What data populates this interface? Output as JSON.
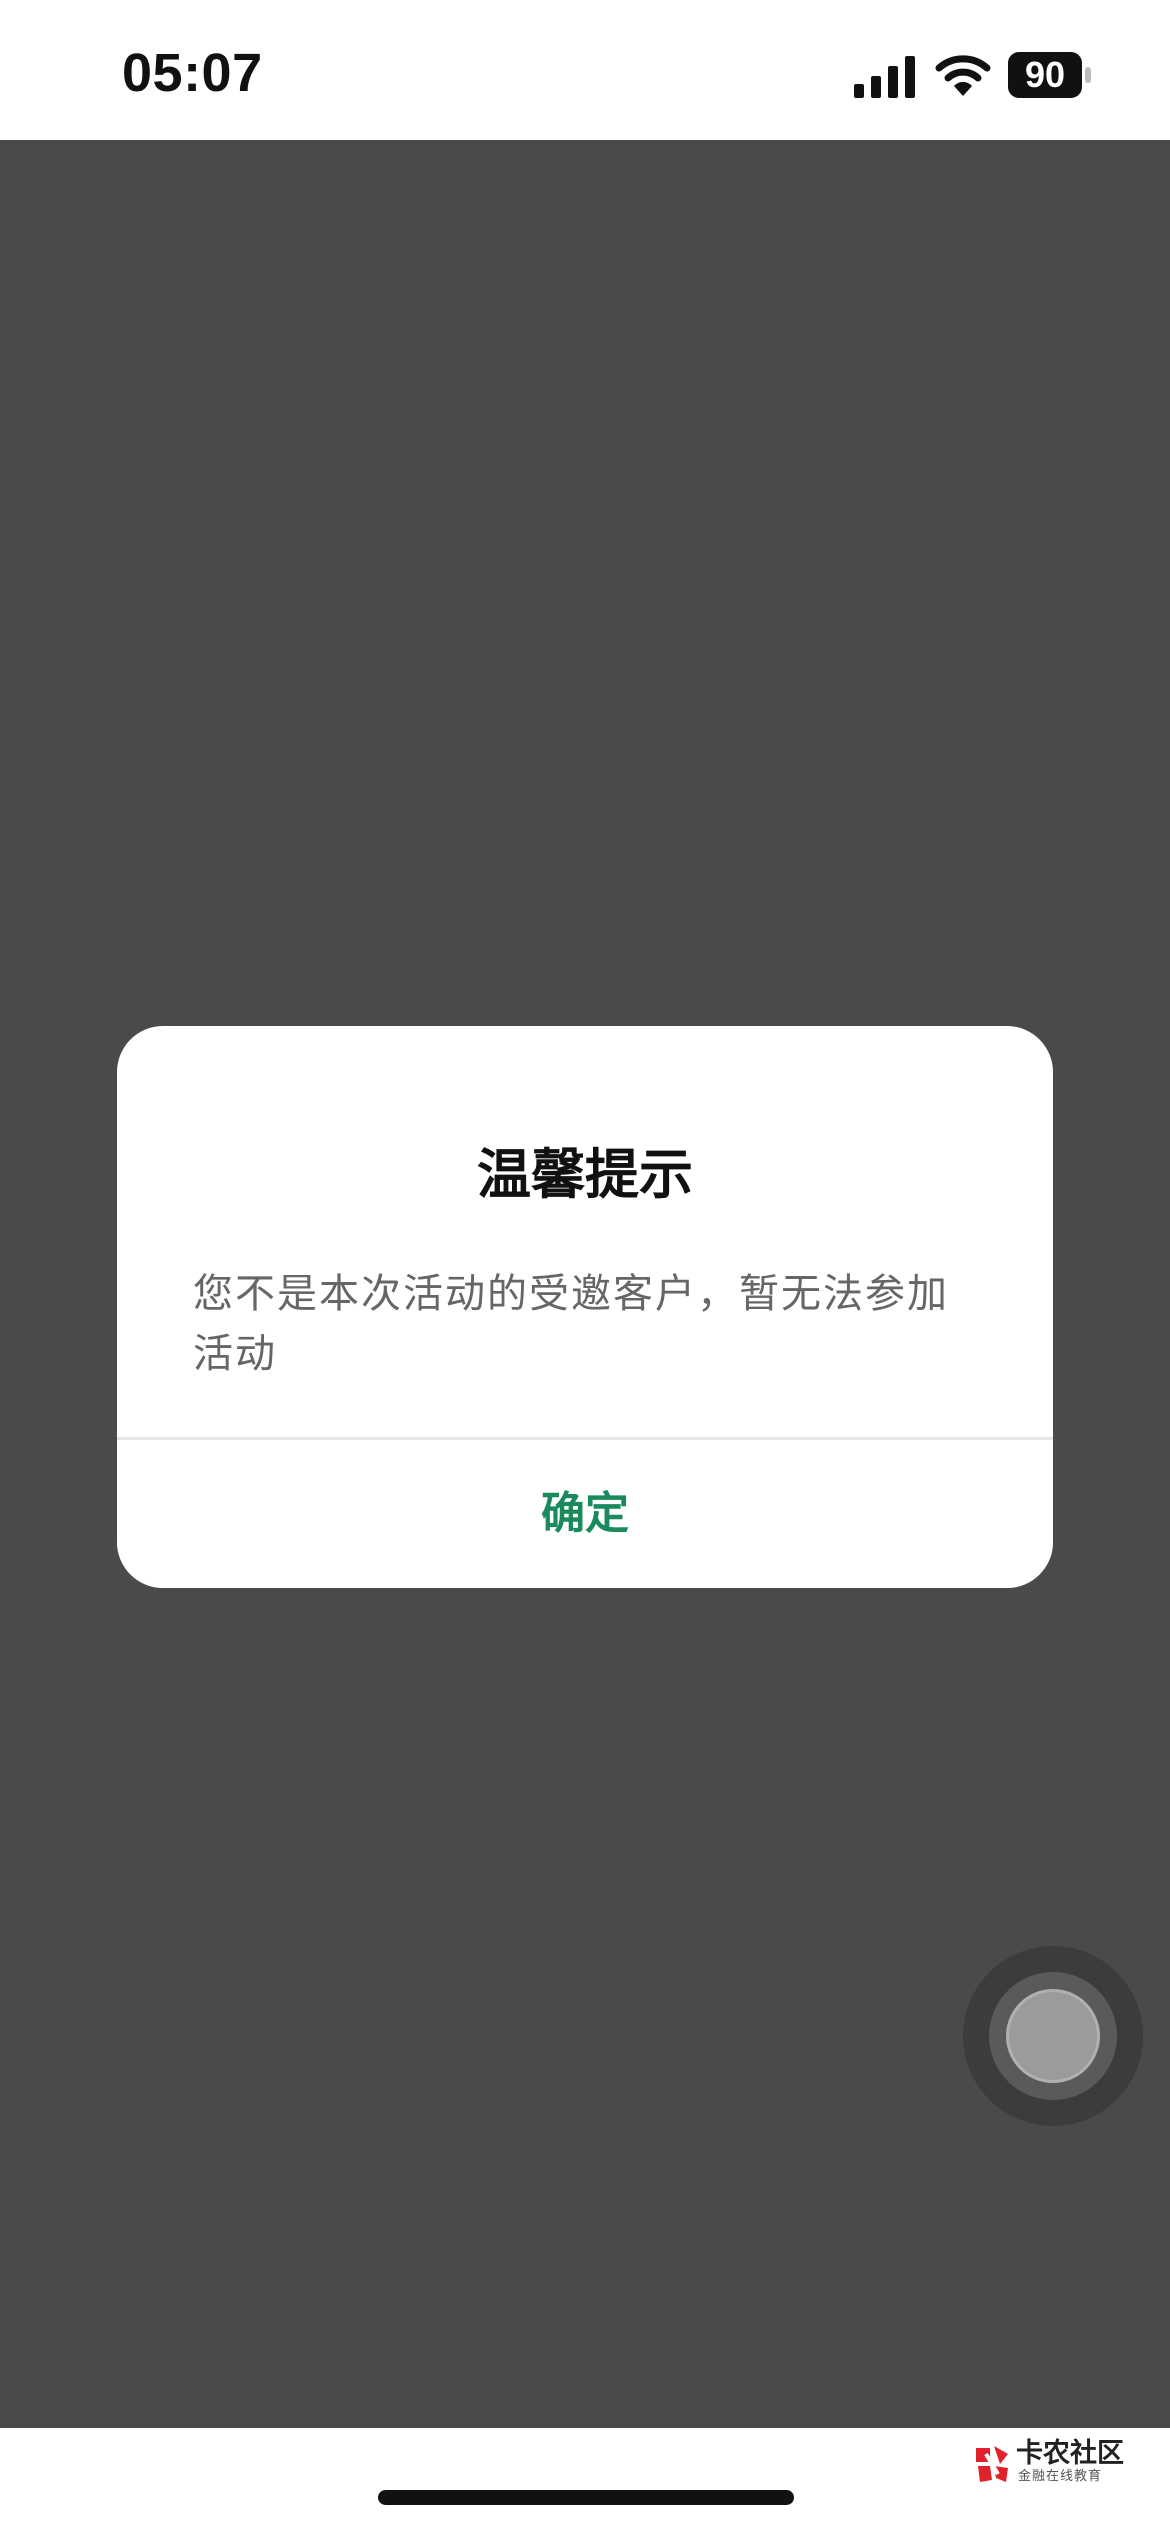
{
  "status_bar": {
    "time": "05:07",
    "battery_level": "90",
    "icons": [
      "signal-icon",
      "wifi-icon",
      "battery-icon"
    ]
  },
  "dialog": {
    "title": "温馨提示",
    "message": "您不是本次活动的受邀客户，暂无法参加活动",
    "confirm_label": "确定"
  },
  "watermark": {
    "name": "卡农社区",
    "subtitle": "金融在线教育"
  },
  "colors": {
    "overlay": "#4a4a4a",
    "accent": "#1a8a5c",
    "watermark_red": "#e0222c"
  }
}
